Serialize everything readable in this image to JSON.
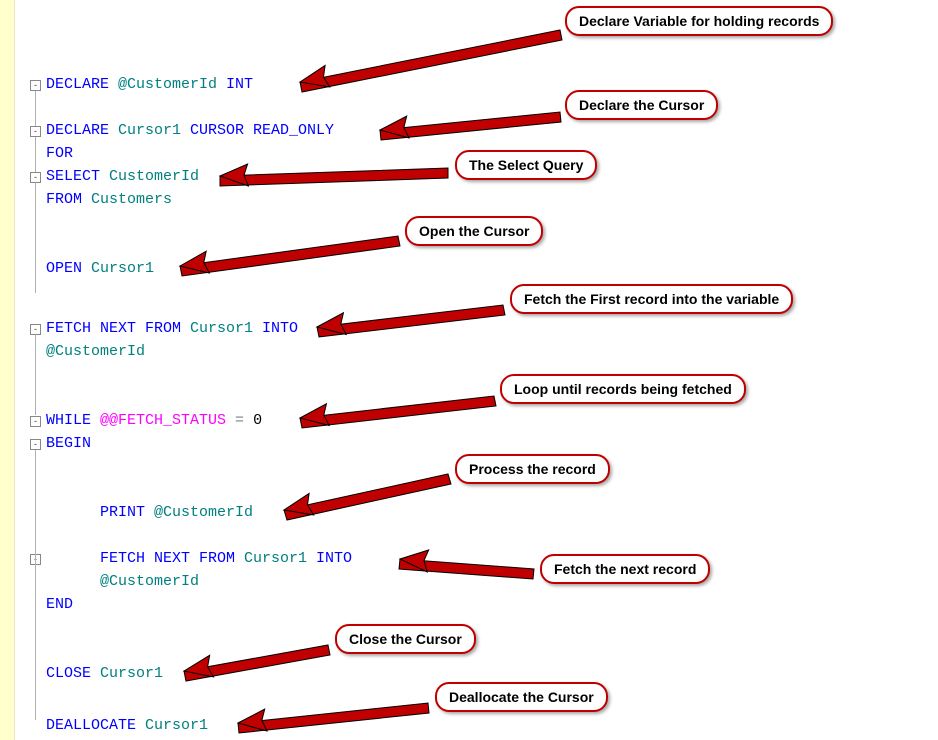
{
  "callouts": {
    "c1": "Declare Variable for holding records",
    "c2": "Declare the Cursor",
    "c3": "The Select Query",
    "c4": "Open the Cursor",
    "c5": "Fetch the First record into the variable",
    "c6": "Loop until records being fetched",
    "c7": "Process the record",
    "c8": "Fetch the next record",
    "c9": "Close the Cursor",
    "c10": "Deallocate the Cursor"
  },
  "code": {
    "l1_kw": "DECLARE ",
    "l1_var": "@CustomerId ",
    "l1_kw2": "INT",
    "l2_kw": "DECLARE ",
    "l2_id": "Cursor1 ",
    "l2_kw2": "CURSOR READ_ONLY",
    "l3_kw": "FOR",
    "l4_kw": "SELECT ",
    "l4_id": "CustomerId",
    "l5_kw": "FROM ",
    "l5_id": "Customers",
    "l6_kw": "OPEN ",
    "l6_id": "Cursor1",
    "l7_kw": "FETCH NEXT FROM ",
    "l7_id": "Cursor1 ",
    "l7_kw2": "INTO",
    "l8_var": "@CustomerId",
    "l9_kw": "WHILE ",
    "l9_sys": "@@FETCH_STATUS ",
    "l9_op": "= ",
    "l9_num": "0",
    "l10_kw": "BEGIN",
    "l11_kw": "PRINT ",
    "l11_var": "@CustomerId",
    "l12_kw": "FETCH NEXT FROM ",
    "l12_id": "Cursor1 ",
    "l12_kw2": "INTO",
    "l13_var": "@CustomerId",
    "l14_kw": "END",
    "l15_kw": "CLOSE ",
    "l15_id": "Cursor1",
    "l16_kw": "DEALLOCATE ",
    "l16_id": "Cursor1"
  },
  "fold": {
    "minus": "-"
  }
}
